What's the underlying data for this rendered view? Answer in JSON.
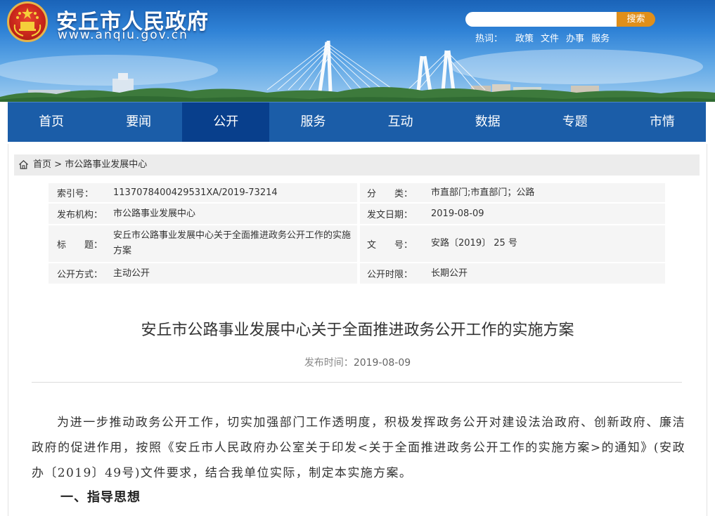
{
  "header": {
    "site_title": "安丘市人民政府",
    "site_url": "www.anqiu.gov.cn",
    "search_button": "搜索",
    "search_placeholder": "",
    "hot_label": "热词：",
    "hot_words": [
      "政策",
      "文件",
      "办事",
      "服务"
    ]
  },
  "nav": {
    "items": [
      {
        "label": "首页"
      },
      {
        "label": "要闻"
      },
      {
        "label": "公开",
        "active": true
      },
      {
        "label": "服务"
      },
      {
        "label": "互动"
      },
      {
        "label": "数据"
      },
      {
        "label": "专题"
      },
      {
        "label": "市情"
      }
    ]
  },
  "breadcrumb": {
    "home": "首页",
    "separator": ">",
    "current": "市公路事业发展中心"
  },
  "meta": {
    "index_label": "索引号：",
    "index_value": "1137078400429531XA/2019-73214",
    "category_label": "分　　类：",
    "category_value": "市直部门;市直部门；公路",
    "org_label": "发布机构：",
    "org_value": "市公路事业发展中心",
    "date_label": "发文日期：",
    "date_value": "2019-08-09",
    "title_label": "标　　题：",
    "title_value": "安丘市公路事业发展中心关于全面推进政务公开工作的实施方案",
    "docno_label": "文　　号：",
    "docno_value": "安路〔2019〕 25 号",
    "mode_label": "公开方式：",
    "mode_value": "主动公开",
    "period_label": "公开时限：",
    "period_value": "长期公开"
  },
  "article": {
    "title": "安丘市公路事业发展中心关于全面推进政务公开工作的实施方案",
    "pub_label": "发布时间：",
    "pub_date": "2019-08-09",
    "paragraph": "为进一步推动政务公开工作，切实加强部门工作透明度，积极发挥政务公开对建设法治政府、创新政府、廉洁政府的促进作用，按照《安丘市人民政府办公室关于印发<关于全面推进政务公开工作的实施方案>的通知》(安政办〔2019〕49号)文件要求，结合我单位实际，制定本实施方案。",
    "section1": "一、指导思想"
  },
  "colors": {
    "nav_bg": "#1b5da8",
    "nav_active": "#083f8c",
    "search_button": "#e08f1a",
    "breadcrumb_bg": "#ececec",
    "meta_bg": "#f5f5f5"
  },
  "icons": {
    "emblem": "national-emblem",
    "breadcrumb_home": "home-icon"
  }
}
